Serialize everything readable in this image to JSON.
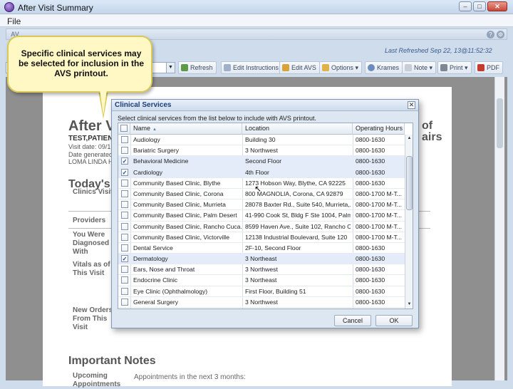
{
  "window": {
    "title": "After Visit Summary"
  },
  "menu": {
    "file": "File"
  },
  "app": {
    "last_refreshed": "Last Refreshed Sep 22, 13@11:52:32"
  },
  "toolbar": {
    "refresh": "Refresh",
    "edit_instructions": "Edit Instructions",
    "edit_avs": "Edit AVS",
    "options": "Options",
    "krames": "Krames",
    "note": "Note",
    "print": "Print",
    "pdf": "PDF"
  },
  "document": {
    "title": "After V",
    "patient": "TEST,PATIEN",
    "visit_date": "Visit date: 09/1",
    "date_generated": "Date generated",
    "facility": "LOMA LINDA HC",
    "right_title_1": "of",
    "right_title_2": "airs",
    "todays": "Today's",
    "clinics_visit": "Clinics Visit",
    "providers": "Providers",
    "diagnosed": "You Were Diagnosed With",
    "vitals": "Vitals as of This Visit",
    "new_orders": "New Orders From This Visit",
    "important_notes": "Important Notes",
    "upcoming": "Upcoming Appointments",
    "appointments_text": "Appointments in the next 3 months:"
  },
  "callout": {
    "text": "Specific clinical services may be selected for inclusion in the AVS printout."
  },
  "dialog": {
    "title": "Clinical Services",
    "instruction": "Select clinical services from the list below to include with AVS printout.",
    "columns": {
      "name": "Name",
      "location": "Location",
      "hours": "Operating Hours"
    },
    "rows": [
      {
        "name": "Audiology",
        "location": "Building 30",
        "hours": "0800-1630",
        "checked": false
      },
      {
        "name": "Bariatric Surgery",
        "location": "3 Northwest",
        "hours": "0800-1630",
        "checked": false
      },
      {
        "name": "Behavioral Medicine",
        "location": "Second Floor",
        "hours": "0800-1630",
        "checked": true
      },
      {
        "name": "Cardiology",
        "location": "4th Floor",
        "hours": "0800-1630",
        "checked": true
      },
      {
        "name": "Community Based Clinic, Blythe",
        "location": "1273 Hobson Way, Blythe, CA 92225",
        "hours": "0800-1630",
        "checked": false
      },
      {
        "name": "Community Based Clinic, Corona",
        "location": "800 MAGNOLIA, Corona, CA 92879",
        "hours": "0800-1700 M-T...",
        "checked": false
      },
      {
        "name": "Community Based Clinic, Murrieta",
        "location": "28078 Baxter Rd., Suite 540, Murrieta,...",
        "hours": "0800-1700 M-T...",
        "checked": false
      },
      {
        "name": "Community Based Clinic, Palm Desert",
        "location": "41-990 Cook St, Bldg F Ste 1004, Palm...",
        "hours": "0800-1700 M-T...",
        "checked": false
      },
      {
        "name": "Community Based Clinic, Rancho Cuca...",
        "location": "8599 Haven Ave., Suite 102, Rancho Cu...",
        "hours": "0800-1700 M-T...",
        "checked": false
      },
      {
        "name": "Community Based Clinic, Victorville",
        "location": "12138 Industrial Boulevard, Suite 120",
        "hours": "0800-1700 M-T...",
        "checked": false
      },
      {
        "name": "Dental Service",
        "location": "2F-10, Second Floor",
        "hours": "0800-1630",
        "checked": false
      },
      {
        "name": "Dermatology",
        "location": "3 Northeast",
        "hours": "0800-1630",
        "checked": true
      },
      {
        "name": "Ears, Nose and Throat",
        "location": "3 Northwest",
        "hours": "0800-1630",
        "checked": false
      },
      {
        "name": "Endocrine Clinic",
        "location": "3 Northeast",
        "hours": "0800-1630",
        "checked": false
      },
      {
        "name": "Eye Clinic (Ophthalmology)",
        "location": "First Floor, Building 51",
        "hours": "0800-1630",
        "checked": false
      },
      {
        "name": "General Surgery",
        "location": "3 Northwest",
        "hours": "0800-1630",
        "checked": false
      }
    ],
    "cancel": "Cancel",
    "ok": "OK"
  }
}
